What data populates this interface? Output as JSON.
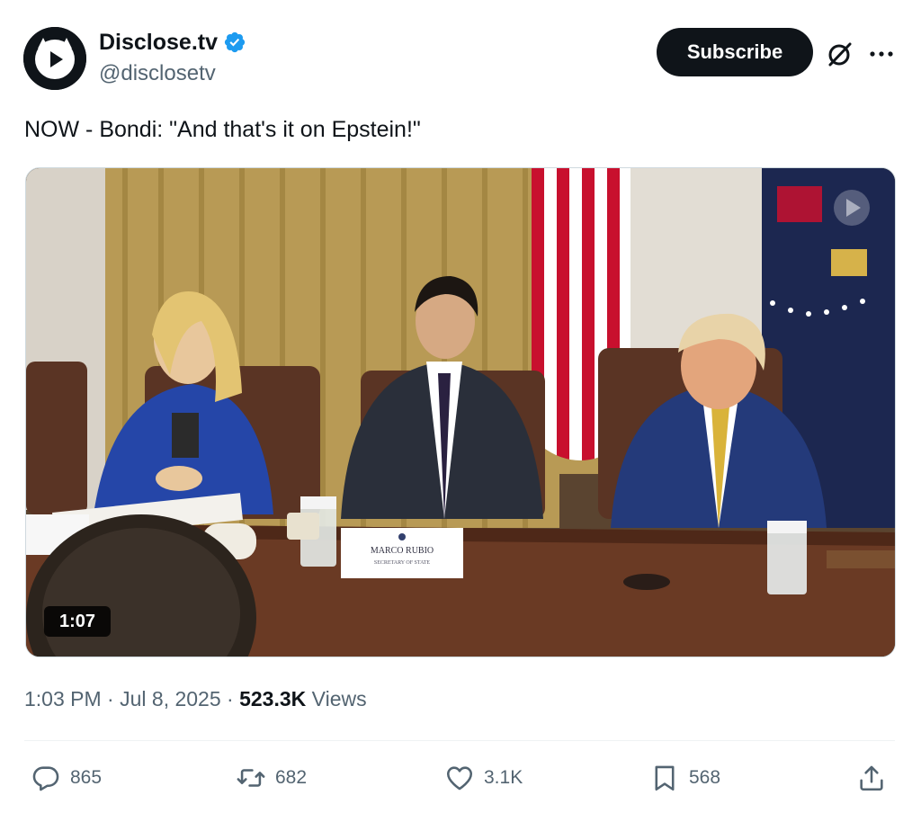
{
  "author": {
    "display_name": "Disclose.tv",
    "handle": "@disclosetv",
    "verified": true,
    "verified_badge_color": "#1d9bf0"
  },
  "header": {
    "subscribe_label": "Subscribe",
    "grok_icon": "grok-icon",
    "more_icon": "more-icon"
  },
  "post": {
    "text": "NOW - Bondi: \"And that's it on Epstein!\""
  },
  "media": {
    "type": "video",
    "duration": "1:07",
    "placard_name": "MARCO RUBIO",
    "placard_title": "SECRETARY OF STATE"
  },
  "meta": {
    "time": "1:03 PM",
    "separator": " · ",
    "date": "Jul 8, 2025",
    "views_count": "523.3K",
    "views_label": " Views"
  },
  "actions": {
    "replies": "865",
    "reposts": "682",
    "likes": "3.1K",
    "bookmarks": "568"
  },
  "colors": {
    "text_primary": "#0f1419",
    "text_secondary": "#536471",
    "accent": "#1d9bf0"
  }
}
